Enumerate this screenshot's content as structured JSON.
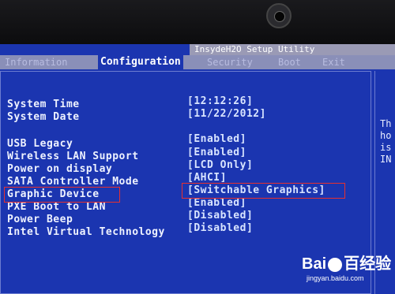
{
  "header": {
    "title": "InsydeH2O Setup Utility"
  },
  "menu": {
    "items": [
      {
        "label": "Information",
        "active": false
      },
      {
        "label": "Configuration",
        "active": true
      },
      {
        "label": "Security",
        "active": false
      },
      {
        "label": "Boot",
        "active": false
      },
      {
        "label": "Exit",
        "active": false
      }
    ]
  },
  "settings": [
    {
      "label": "System Time",
      "value": "[12:12:26]"
    },
    {
      "label": "System Date",
      "value": "[11/22/2012]"
    },
    {
      "label": "USB Legacy",
      "value": "[Enabled]"
    },
    {
      "label": "Wireless LAN Support",
      "value": "[Enabled]"
    },
    {
      "label": "Power on display",
      "value": "[LCD Only]"
    },
    {
      "label": "SATA Controller Mode",
      "value": "[AHCI]"
    },
    {
      "label": "Graphic Device",
      "value": "[Switchable Graphics]"
    },
    {
      "label": "PXE Boot to LAN",
      "value": "[Enabled]"
    },
    {
      "label": "Power Beep",
      "value": "[Disabled]"
    },
    {
      "label": "Intel Virtual Technology",
      "value": "[Disabled]"
    }
  ],
  "help": {
    "text": "Th\nho\nis\nIN"
  },
  "watermark": {
    "brand": "Bai",
    "brand2": "百",
    "suffix": "经验",
    "url": "jingyan.baidu.com"
  },
  "colors": {
    "bios_bg": "#1b35b0",
    "menu_bg": "#8a8fb8",
    "highlight": "#e53030"
  }
}
